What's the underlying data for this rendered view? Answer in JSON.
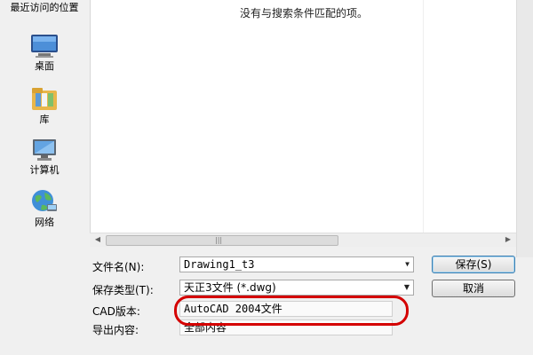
{
  "places": {
    "recent": "最近访问的位置",
    "desktop": "桌面",
    "library": "库",
    "computer": "计算机",
    "network": "网络"
  },
  "filelist": {
    "empty_message": "没有与搜索条件匹配的项。"
  },
  "form": {
    "filename_label": "文件名(N):",
    "filename_value": "Drawing1_t3",
    "filetype_label": "保存类型(T):",
    "filetype_value": "天正3文件 (*.dwg)",
    "cad_version_label": "CAD版本:",
    "cad_version_value": "AutoCAD 2004文件",
    "export_label": "导出内容:",
    "export_value": "全部内容"
  },
  "buttons": {
    "save": "保存(S)",
    "cancel": "取消"
  },
  "colors": {
    "highlight": "#d40000",
    "window_bg": "#f0f0f0"
  }
}
